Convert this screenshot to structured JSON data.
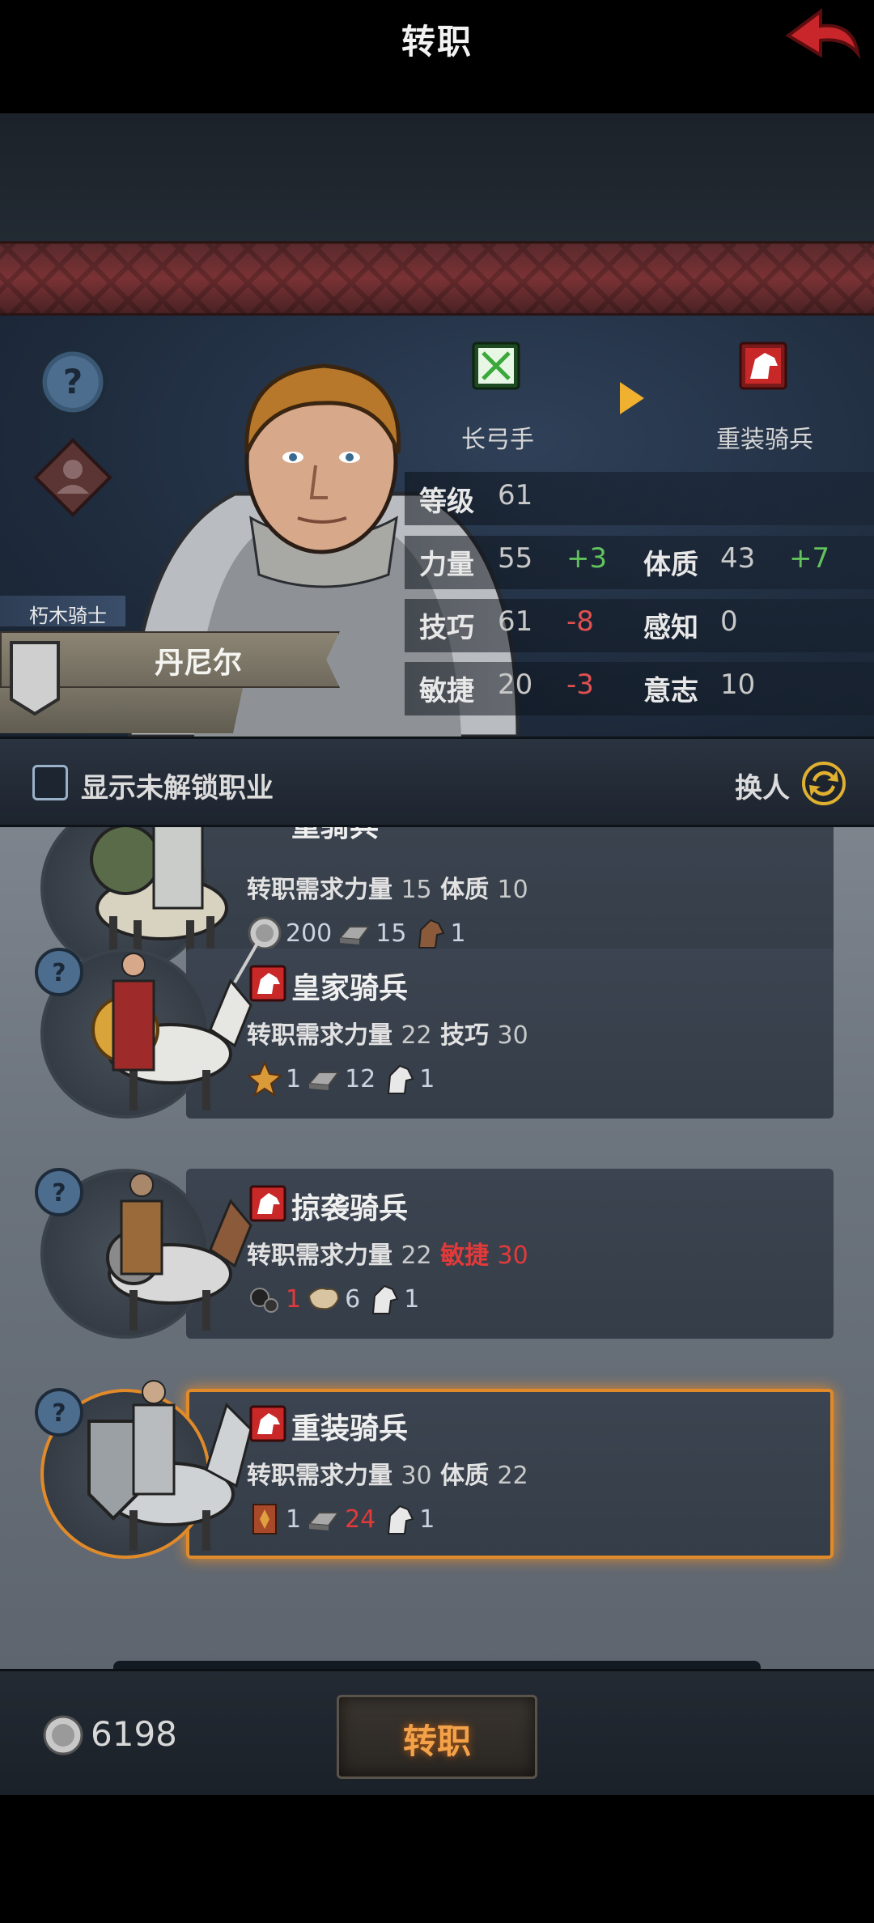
{
  "header": {
    "title": "转职"
  },
  "hero": {
    "title_tag": "朽木骑士",
    "name": "丹尼尔",
    "class_from": "长弓手",
    "class_to": "重装骑兵",
    "stats": {
      "level_label": "等级",
      "level_value": "61",
      "str_label": "力量",
      "str_value": "55",
      "str_delta": "+3",
      "con_label": "体质",
      "con_value": "43",
      "con_delta": "+7",
      "skill_label": "技巧",
      "skill_value": "61",
      "skill_delta": "-8",
      "per_label": "感知",
      "per_value": "0",
      "agi_label": "敏捷",
      "agi_value": "20",
      "agi_delta": "-3",
      "will_label": "意志",
      "will_value": "10"
    }
  },
  "filter": {
    "label": "显示未解锁职业",
    "checked": false,
    "swap_label": "换人"
  },
  "jobs": [
    {
      "name": "重骑兵",
      "req_prefix": "转职需求",
      "req1_label": "力量",
      "req1_value": "15",
      "req2_label": "体质",
      "req2_value": "10",
      "costs": [
        "200",
        "15",
        "1"
      ]
    },
    {
      "name": "皇家骑兵",
      "req_prefix": "转职需求",
      "req1_label": "力量",
      "req1_value": "22",
      "req2_label": "技巧",
      "req2_value": "30",
      "costs": [
        "1",
        "12",
        "1"
      ]
    },
    {
      "name": "掠袭骑兵",
      "req_prefix": "转职需求",
      "req1_label": "力量",
      "req1_value": "22",
      "req2_label": "敏捷",
      "req2_value": "30",
      "costs": [
        "1",
        "6",
        "1"
      ]
    },
    {
      "name": "重装骑兵",
      "req_prefix": "转职需求",
      "req1_label": "力量",
      "req1_value": "30",
      "req2_label": "体质",
      "req2_value": "22",
      "costs": [
        "1",
        "24",
        "1"
      ]
    }
  ],
  "footer": {
    "currency": "6198",
    "action_label": "转职"
  },
  "colors": {
    "accent_orange": "#e08a2a",
    "positive": "#62c35d",
    "negative": "#e05050",
    "title_red": "#7a3235"
  }
}
